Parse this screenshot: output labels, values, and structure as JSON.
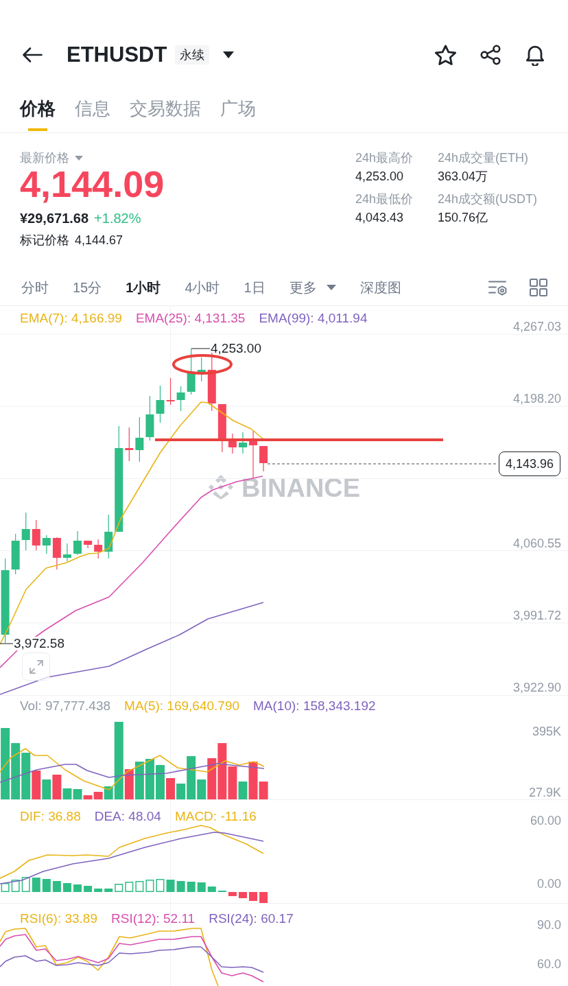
{
  "header": {
    "symbol": "ETHUSDT",
    "badge": "永续"
  },
  "tabs": [
    {
      "label": "价格",
      "selected": true
    },
    {
      "label": "信息",
      "selected": false
    },
    {
      "label": "交易数据",
      "selected": false
    },
    {
      "label": "广场",
      "selected": false
    }
  ],
  "price": {
    "label": "最新价格",
    "last": "4,144.09",
    "fiat": "¥29,671.68",
    "change": "+1.82%",
    "mark_label": "标记价格",
    "mark_value": "4,144.67"
  },
  "stats": [
    {
      "label": "24h最高价",
      "value": "4,253.00"
    },
    {
      "label": "24h成交量(ETH)",
      "value": "363.04万"
    },
    {
      "label": "24h最低价",
      "value": "4,043.43"
    },
    {
      "label": "24h成交额(USDT)",
      "value": "150.76亿"
    }
  ],
  "intervals": [
    {
      "label": "分时",
      "kind": "tab",
      "selected": false
    },
    {
      "label": "15分",
      "kind": "tab",
      "selected": false
    },
    {
      "label": "1小时",
      "kind": "tab",
      "selected": true
    },
    {
      "label": "4小时",
      "kind": "tab",
      "selected": false
    },
    {
      "label": "1日",
      "kind": "tab",
      "selected": false
    },
    {
      "label": "更多",
      "kind": "menu",
      "selected": false
    },
    {
      "label": "深度图",
      "kind": "tab",
      "selected": false
    }
  ],
  "price_chart": {
    "legend": [
      {
        "label": "EMA(7): 4,166.99",
        "color": "#e9b416"
      },
      {
        "label": "EMA(25): 4,131.35",
        "color": "#d84fae"
      },
      {
        "label": "EMA(99): 4,011.94",
        "color": "#7f63bf"
      }
    ],
    "axis_labels": [
      "4,267.03",
      "4,198.20",
      "4,060.55",
      "3,991.72",
      "3,922.90"
    ],
    "high_label": "4,253.00",
    "low_label": "3,972.58",
    "last_price": "4,143.96",
    "watermark": "BINANCE"
  },
  "volume_chart": {
    "legend": [
      {
        "label": "Vol: 97,777.438",
        "color": "#929aa5"
      },
      {
        "label": "MA(5): 169,640.790",
        "color": "#e9b416"
      },
      {
        "label": "MA(10): 158,343.192",
        "color": "#7f63bf"
      }
    ],
    "axis_labels": [
      "395K",
      "27.9K"
    ]
  },
  "macd_chart": {
    "legend": [
      {
        "label": "DIF: 36.88",
        "color": "#e9b416"
      },
      {
        "label": "DEA: 48.04",
        "color": "#7f63bf"
      },
      {
        "label": "MACD: -11.16",
        "color": "#e9b416"
      }
    ],
    "axis_labels": [
      "60.00",
      "0.00"
    ]
  },
  "rsi_chart": {
    "legend": [
      {
        "label": "RSI(6): 33.89",
        "color": "#e9b416"
      },
      {
        "label": "RSI(12): 52.11",
        "color": "#d84fae"
      },
      {
        "label": "RSI(24): 60.17",
        "color": "#7f63bf"
      }
    ],
    "axis_labels": [
      "90.0",
      "60.0"
    ]
  }
}
